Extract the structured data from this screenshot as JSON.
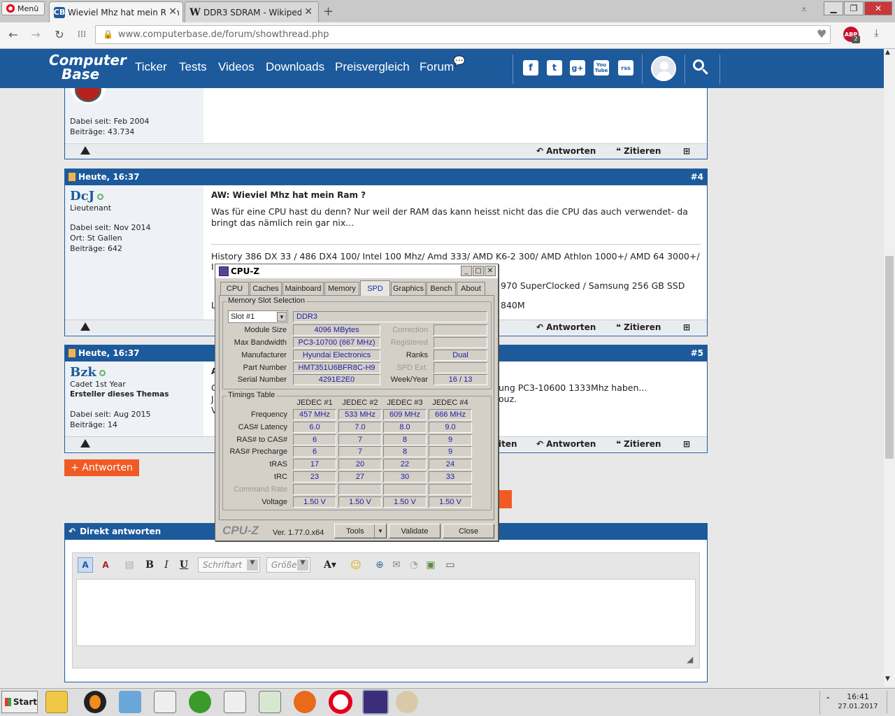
{
  "browser": {
    "menu_label": "Menü",
    "tabs": [
      {
        "title": "Wieviel Mhz hat mein Ram ?",
        "fav": "CB"
      },
      {
        "title": "DDR3 SDRAM - Wikipedia",
        "fav": "W"
      }
    ],
    "new_tab": "+",
    "url": "www.computerbase.de/forum/showthread.php",
    "adblock_badge": "ABP",
    "adblock_count": "2"
  },
  "site": {
    "logo_line1": "Computer",
    "logo_line2": "Base",
    "nav": [
      "Ticker",
      "Tests",
      "Videos",
      "Downloads",
      "Preisvergleich",
      "Forum"
    ],
    "social": [
      "f",
      "t",
      "g+",
      "You Tube",
      "rss"
    ]
  },
  "posts": {
    "prev": {
      "joined": "Dabei seit: Feb 2004",
      "count": "Beiträge: 43.734"
    },
    "p4": {
      "time": "Heute, 16:37",
      "num": "#4",
      "user": "DcJ",
      "rank": "Lieutenant",
      "joined": "Dabei seit: Nov 2014",
      "location": "Ort: St Gallen",
      "count": "Beiträge: 642",
      "title": "AW: Wieviel Mhz hat mein Ram ?",
      "body": "Was für eine CPU hast du denn? Nur weil der RAM das kann heisst nicht das die CPU das auch verwendet- da bringt das nämlich rein gar nix...",
      "sig1": "History 386 DX 33 / 486 DX4 100/ Intel 100 Mhz/ Amd 333/ AMD K6-2 300/ AMD Athlon 1000+/ AMD 64 3000+/",
      "sig1b": "I",
      "sig2": "970 SuperClocked / Samsung 256 GB SSD",
      "sig3a": "L",
      "sig3b": "840M"
    },
    "p5": {
      "time": "Heute, 16:37",
      "num": "#5",
      "user": "Bzk",
      "rank": "Cadet 1st Year",
      "starter": "Ersteller dieses Themas",
      "joined": "Dabei seit: Aug 2015",
      "count": "Beiträge: 14",
      "frag_title": "A",
      "frag1": "ung PC3-10600 1333Mhz haben...",
      "frag1a": "C",
      "frag2": "ouz.",
      "frag2a": "J",
      "frag3a": "V"
    },
    "reply": "Antworten",
    "quote": "Zitieren",
    "reply_partial": "iten",
    "answer_btn": "+ Antworten"
  },
  "quick_reply": {
    "title": "Direkt antworten",
    "font_placeholder": "Schriftart",
    "size_placeholder": "Größe"
  },
  "cpuz": {
    "title": "CPU-Z",
    "tabs": [
      "CPU",
      "Caches",
      "Mainboard",
      "Memory",
      "SPD",
      "Graphics",
      "Bench",
      "About"
    ],
    "active_tab": "SPD",
    "slot_group": "Memory Slot Selection",
    "slot": "Slot #1",
    "type": "DDR3",
    "labels": {
      "module_size": "Module Size",
      "max_bandwidth": "Max Bandwidth",
      "manufacturer": "Manufacturer",
      "part_number": "Part Number",
      "serial_number": "Serial Number",
      "correction": "Correction",
      "registered": "Registered",
      "ranks": "Ranks",
      "spd_ext": "SPD Ext.",
      "week_year": "Week/Year"
    },
    "values": {
      "module_size": "4096 MBytes",
      "max_bandwidth": "PC3-10700 (667 MHz)",
      "manufacturer": "Hyundai Electronics",
      "part_number": "HMT351U6BFR8C-H9",
      "serial_number": "4291E2E0",
      "ranks": "Dual",
      "week_year": "16 / 13"
    },
    "timings_group": "Timings Table",
    "jedec_headers": [
      "JEDEC #1",
      "JEDEC #2",
      "JEDEC #3",
      "JEDEC #4"
    ],
    "timing_rows": [
      {
        "label": "Frequency",
        "values": [
          "457 MHz",
          "533 MHz",
          "609 MHz",
          "666 MHz"
        ]
      },
      {
        "label": "CAS# Latency",
        "values": [
          "6.0",
          "7.0",
          "8.0",
          "9.0"
        ]
      },
      {
        "label": "RAS# to CAS#",
        "values": [
          "6",
          "7",
          "8",
          "9"
        ]
      },
      {
        "label": "RAS# Precharge",
        "values": [
          "6",
          "7",
          "8",
          "9"
        ]
      },
      {
        "label": "tRAS",
        "values": [
          "17",
          "20",
          "22",
          "24"
        ]
      },
      {
        "label": "tRC",
        "values": [
          "23",
          "27",
          "30",
          "33"
        ]
      },
      {
        "label": "Command Rate",
        "values": [
          "",
          "",
          "",
          ""
        ]
      },
      {
        "label": "Voltage",
        "values": [
          "1.50 V",
          "1.50 V",
          "1.50 V",
          "1.50 V"
        ]
      }
    ],
    "brand": "CPU-Z",
    "version": "Ver. 1.77.0.x64",
    "tools": "Tools",
    "validate": "Validate",
    "close": "Close"
  },
  "taskbar": {
    "start": "Start",
    "time": "16:41",
    "date": "27.01.2017"
  },
  "colors": {
    "brand": "#1d5a9c",
    "orange": "#f05a24",
    "cpuz_value": "#2020a0"
  }
}
